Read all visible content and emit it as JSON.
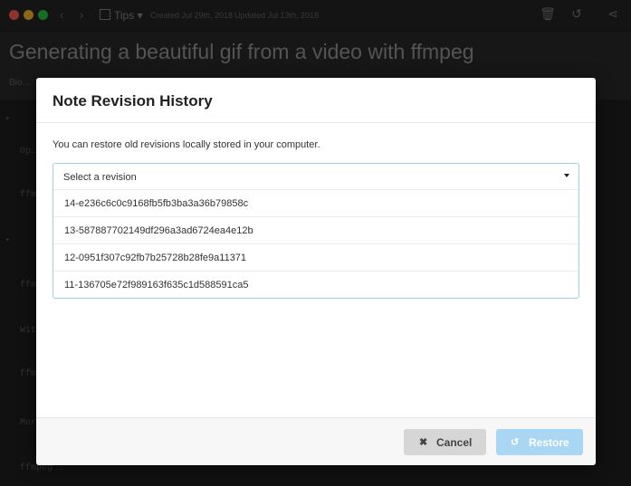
{
  "titlebar": {
    "notebook": "Tips",
    "created": "Created Jul 29th, 2018",
    "updated": "Updated Jul 13th, 2018"
  },
  "note": {
    "title": "Generating a beautiful gif from a video with ffmpeg"
  },
  "modal": {
    "title": "Note Revision History",
    "description": "You can restore old revisions locally stored in your computer.",
    "select": {
      "placeholder": "Select a revision",
      "options": [
        "14-e236c6c0c9168fb5fb3ba3a36b79858c",
        "13-587887702149df296a3ad6724ea4e12b",
        "12-0951f307c92fb7b25728b28fe9a11371",
        "11-136705e72f989163f635c1d588591ca5"
      ]
    },
    "buttons": {
      "cancel": "Cancel",
      "restore": "Restore"
    }
  },
  "colors": {
    "accent_border": "#9fd3dd",
    "restore_button": "#a9d6f2",
    "cancel_button": "#d6d6d6"
  }
}
